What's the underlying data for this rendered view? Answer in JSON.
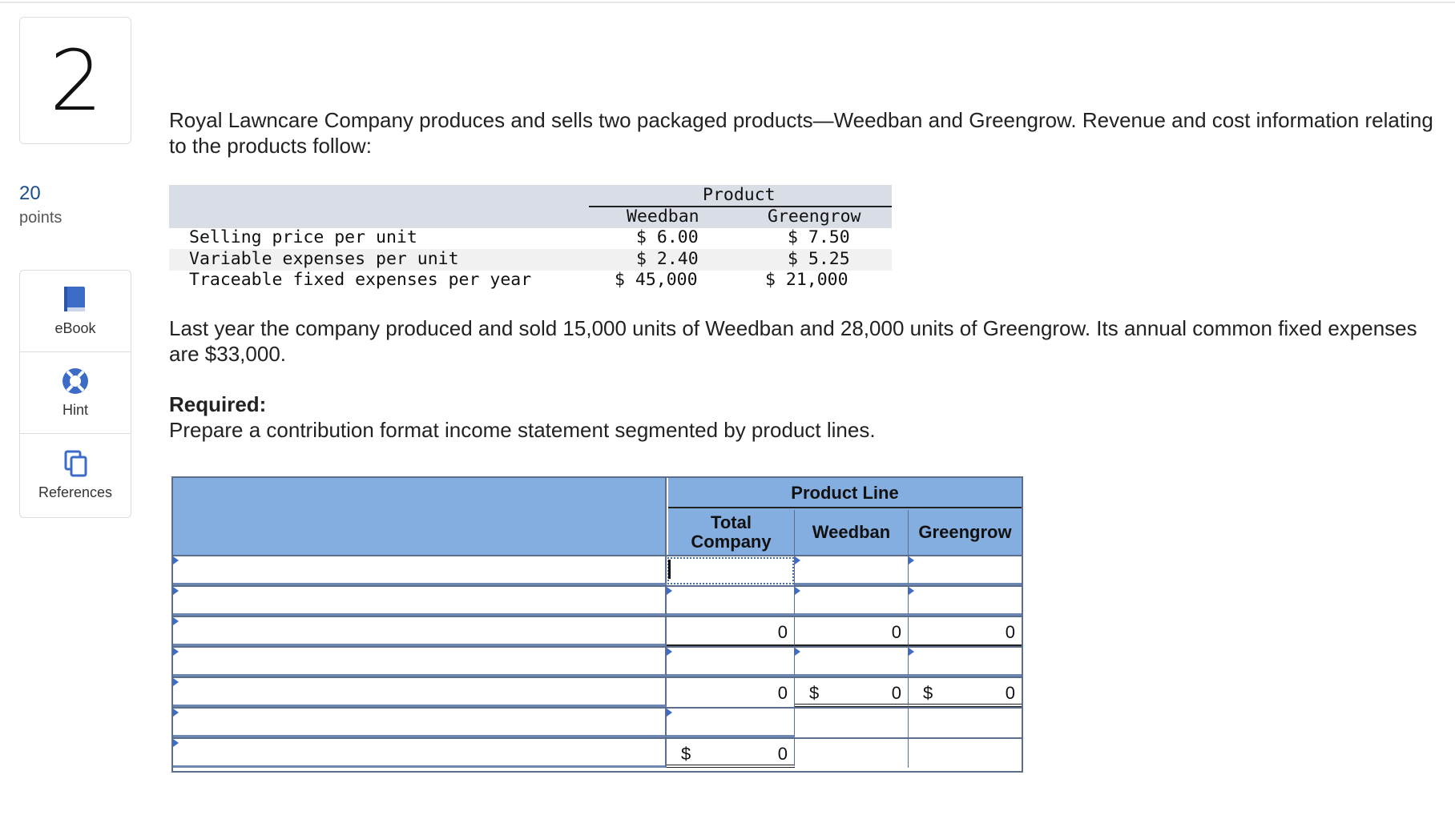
{
  "question": {
    "number": "2",
    "points_value": "20",
    "points_label": "points"
  },
  "tools": [
    {
      "label": "eBook",
      "icon": "book-icon"
    },
    {
      "label": "Hint",
      "icon": "lifebuoy-icon"
    },
    {
      "label": "References",
      "icon": "copy-icon"
    }
  ],
  "intro": "Royal Lawncare Company produces and sells two packaged products—Weedban and Greengrow. Revenue and cost information relating to the products follow:",
  "data_table": {
    "group_header": "Product",
    "col1": "Weedban",
    "col2": "Greengrow",
    "rows": [
      {
        "label": "Selling price per unit",
        "weedban": "$ 6.00",
        "greengrow": "$ 7.50"
      },
      {
        "label": "Variable expenses per unit",
        "weedban": "$ 2.40",
        "greengrow": "$ 5.25"
      },
      {
        "label": "Traceable fixed expenses per year",
        "weedban": "$ 45,000",
        "greengrow": "$ 21,000"
      }
    ]
  },
  "paragraph2": "Last year the company produced and sold 15,000 units of Weedban and 28,000 units of Greengrow. Its annual common fixed expenses are $33,000.",
  "required": {
    "title": "Required:",
    "text": "Prepare a contribution format income statement segmented by product lines."
  },
  "answer_grid": {
    "header": "Product Line",
    "col_total": "Total Company",
    "col_weedban": "Weedban",
    "col_greengrow": "Greengrow",
    "rows": [
      {
        "total": "",
        "weedban": "",
        "greengrow": ""
      },
      {
        "total": "",
        "weedban": "",
        "greengrow": ""
      },
      {
        "total": "0",
        "weedban": "0",
        "greengrow": "0"
      },
      {
        "total": "",
        "weedban": "",
        "greengrow": ""
      },
      {
        "total": "0",
        "weedban": "0",
        "greengrow": "0",
        "weedban_dollar": "$",
        "greengrow_dollar": "$"
      },
      {
        "total": "",
        "weedban": "",
        "greengrow": ""
      },
      {
        "total": "0",
        "total_dollar": "$"
      }
    ]
  }
}
